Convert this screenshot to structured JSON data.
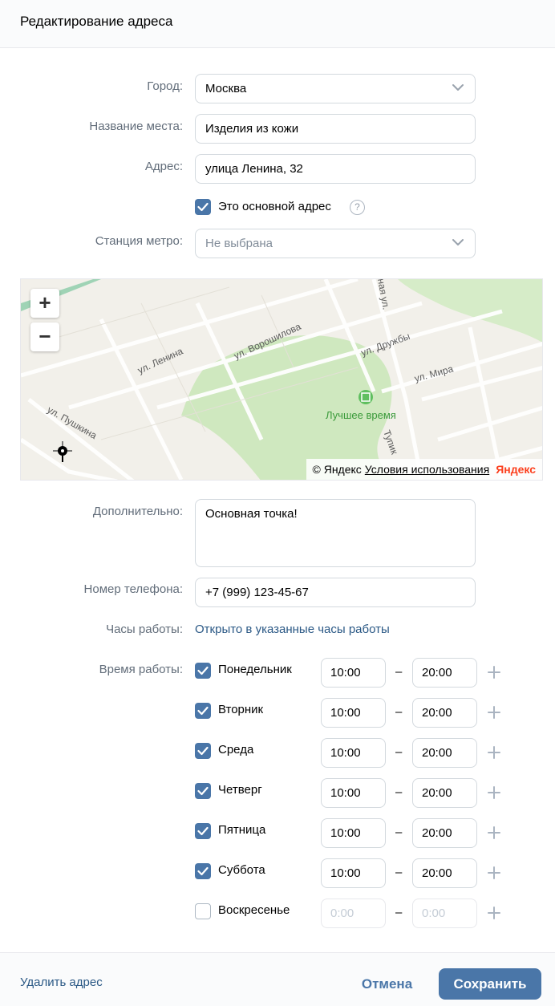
{
  "header": {
    "title": "Редактирование адреса"
  },
  "form": {
    "city": {
      "label": "Город:",
      "value": "Москва"
    },
    "place_name": {
      "label": "Название места:",
      "value": "Изделия из кожи"
    },
    "address": {
      "label": "Адрес:",
      "value": "улица Ленина, 32"
    },
    "main_address": {
      "label": "Это основной адрес",
      "checked": true,
      "help": "?"
    },
    "metro": {
      "label": "Станция метро:",
      "placeholder": "Не выбрана"
    },
    "additional": {
      "label": "Дополнительно:",
      "value": "Основная точка!"
    },
    "phone": {
      "label": "Номер телефона:",
      "value": "+7 (999) 123-45-67"
    },
    "hours_mode": {
      "label": "Часы работы:",
      "value": "Открыто в указанные часы работы"
    },
    "schedule_label": "Время работы:",
    "days": [
      {
        "name": "Понедельник",
        "checked": true,
        "from": "10:00",
        "to": "20:00"
      },
      {
        "name": "Вторник",
        "checked": true,
        "from": "10:00",
        "to": "20:00"
      },
      {
        "name": "Среда",
        "checked": true,
        "from": "10:00",
        "to": "20:00"
      },
      {
        "name": "Четверг",
        "checked": true,
        "from": "10:00",
        "to": "20:00"
      },
      {
        "name": "Пятница",
        "checked": true,
        "from": "10:00",
        "to": "20:00"
      },
      {
        "name": "Суббота",
        "checked": true,
        "from": "10:00",
        "to": "20:00"
      },
      {
        "name": "Воскресенье",
        "checked": false,
        "from": "0:00",
        "to": "0:00"
      }
    ],
    "dash": "–"
  },
  "map": {
    "zoom_in": "+",
    "zoom_out": "−",
    "streets": [
      "ул. Ленина",
      "ул. Ворошилова",
      "ул. Дружбы",
      "ул. Мира",
      "ул. Пушкина",
      "Тупик",
      "Лучшее время"
    ],
    "copyright": "© Яндекс",
    "terms": "Условия использования",
    "logo": "Яндекс"
  },
  "footer": {
    "delete": "Удалить адрес",
    "cancel": "Отмена",
    "save": "Сохранить"
  },
  "colors": {
    "accent": "#4a76a8",
    "link": "#2a5885",
    "label": "#626d7a"
  }
}
